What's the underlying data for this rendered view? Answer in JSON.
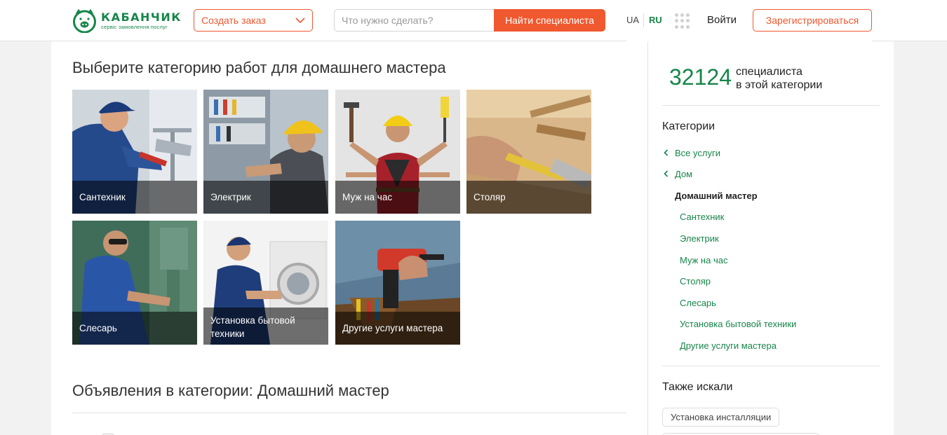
{
  "header": {
    "logo": {
      "name": "КАБАНЧИК",
      "tagline": "сервіс замовлення послуг",
      "brand_color": "#17854a"
    },
    "order_select_label": "Создать заказ",
    "search": {
      "placeholder": "Что нужно сделать?",
      "value": "",
      "button_label": "Найти специалиста"
    },
    "languages": [
      {
        "label": "UA",
        "active": false
      },
      {
        "label": "RU",
        "active": true
      }
    ],
    "apps_icon": "apps-grid-icon",
    "login_label": "Войти",
    "register_label": "Зарегистрироваться"
  },
  "accent_color": "#f0582f",
  "main": {
    "categories_title": "Выберите категорию работ для домашнего мастера",
    "categories": [
      {
        "label": "Сантехник"
      },
      {
        "label": "Электрик"
      },
      {
        "label": "Муж на час"
      },
      {
        "label": "Столяр"
      },
      {
        "label": "Слесарь"
      },
      {
        "label": "Установка бытовой техники"
      },
      {
        "label": "Другие услуги мастера"
      }
    ],
    "ads_title": "Объявления в категории: Домашний мастер"
  },
  "sidebar": {
    "stat_number": "32124",
    "stat_label_line1": "специалиста",
    "stat_label_line2": "в этой категории",
    "categories_heading": "Категории",
    "parents": [
      {
        "label": "Все услуги",
        "icon": "chevron-left-icon"
      },
      {
        "label": "Дом",
        "icon": "chevron-left-icon"
      }
    ],
    "current": "Домашний мастер",
    "children": [
      {
        "label": "Сантехник"
      },
      {
        "label": "Электрик"
      },
      {
        "label": "Муж на час"
      },
      {
        "label": "Столяр"
      },
      {
        "label": "Слесарь"
      },
      {
        "label": "Установка бытовой техники"
      },
      {
        "label": "Другие услуги мастера"
      }
    ],
    "also_searched_heading": "Также искали",
    "also_searched": [
      {
        "label": "Установка инсталляции"
      }
    ]
  }
}
